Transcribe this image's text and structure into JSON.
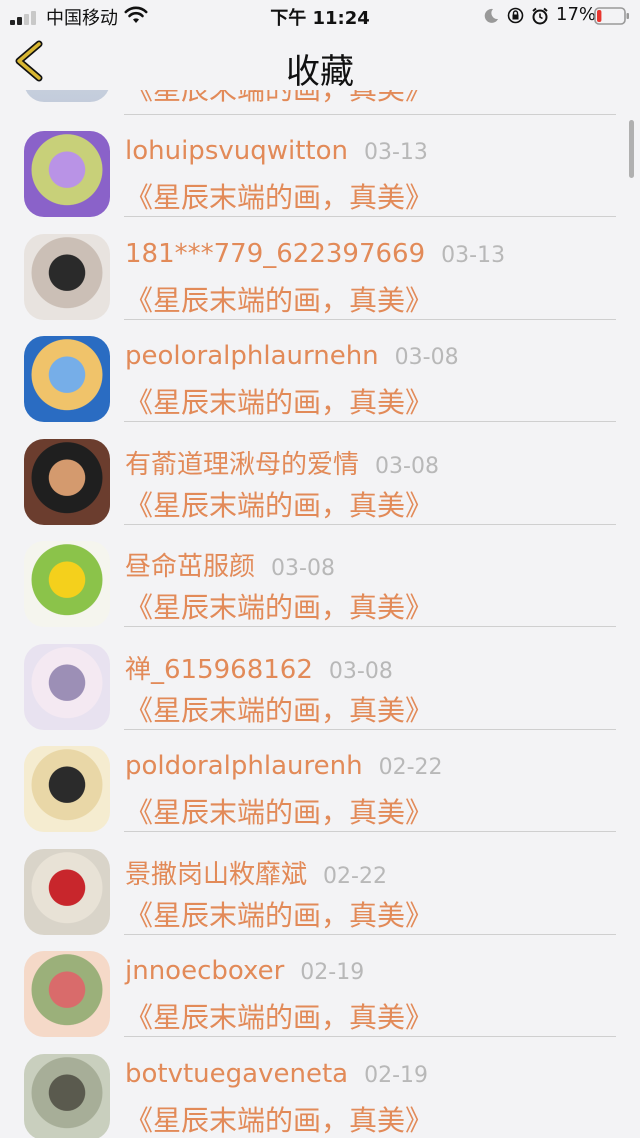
{
  "status": {
    "carrier": "中国移动",
    "time": "下午 11:24",
    "battery": "17%",
    "battery_level": 0.17
  },
  "nav": {
    "title": "收藏"
  },
  "partial_message": "《星辰末端的画，真美》",
  "items": [
    {
      "name": "lohuipsvuqwitton",
      "date": "03-13",
      "message": "《星辰末端的画，真美》",
      "colors": [
        "#8a62c9",
        "#b993e6",
        "#c8d079"
      ]
    },
    {
      "name": "181***779_622397669",
      "date": "03-13",
      "message": "《星辰末端的画，真美》",
      "colors": [
        "#e8e3df",
        "#2a2a2a",
        "#cbbfb6"
      ]
    },
    {
      "name": "peoloralphlaurnehn",
      "date": "03-08",
      "message": "《星辰末端的画，真美》",
      "colors": [
        "#2a6cc2",
        "#76aee8",
        "#f0c36a"
      ]
    },
    {
      "name": "有萮道理湫母的爱情",
      "date": "03-08",
      "message": "《星辰末端的画，真美》",
      "colors": [
        "#6b3d2e",
        "#d49a6e",
        "#1f1f1f"
      ]
    },
    {
      "name": "昼命茁服颜",
      "date": "03-08",
      "message": "《星辰末端的画，真美》",
      "colors": [
        "#f5f5ee",
        "#f4d01c",
        "#8bc34a"
      ]
    },
    {
      "name": "禅_615968162",
      "date": "03-08",
      "message": "《星辰末端的画，真美》",
      "colors": [
        "#e8e2f0",
        "#9c8fb6",
        "#f4e9f2"
      ]
    },
    {
      "name": "poldoralphlaurenh",
      "date": "02-22",
      "message": "《星辰末端的画，真美》",
      "colors": [
        "#f5ecd0",
        "#2b2b2b",
        "#e9d7a7"
      ]
    },
    {
      "name": "景撒岗山敉靡斌",
      "date": "02-22",
      "message": "《星辰末端的画，真美》",
      "colors": [
        "#d9d4c9",
        "#c8262c",
        "#e8e2d6"
      ]
    },
    {
      "name": "jnnoecboxer",
      "date": "02-19",
      "message": "《星辰末端的画，真美》",
      "colors": [
        "#f5d9c8",
        "#d96b6b",
        "#9bb07a"
      ]
    },
    {
      "name": "botvtuegaveneta",
      "date": "02-19",
      "message": "《星辰末端的画，真美》",
      "colors": [
        "#c9cfbe",
        "#5a5a4e",
        "#a7ae98"
      ]
    }
  ]
}
